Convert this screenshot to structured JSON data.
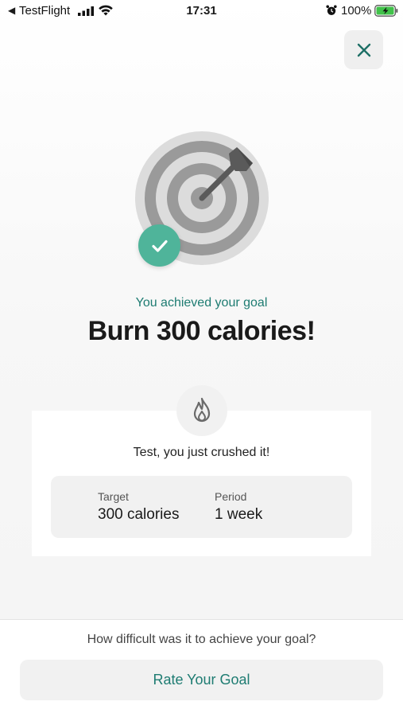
{
  "status_bar": {
    "back_glyph": "◀",
    "app_name": "TestFlight",
    "time": "17:31",
    "battery_percent": "100%",
    "icons": [
      "signal-icon",
      "wifi-icon",
      "alarm-icon",
      "battery-charging-icon"
    ]
  },
  "header": {
    "close_icon": "close-icon"
  },
  "hero": {
    "illustration": "target-dart-icon",
    "badge_icon": "check-icon",
    "subtitle": "You achieved your goal",
    "title": "Burn 300 calories!"
  },
  "card": {
    "icon": "flame-icon",
    "message": "Test, you just crushed it!",
    "stats": [
      {
        "label": "Target",
        "value": "300 calories"
      },
      {
        "label": "Period",
        "value": "1 week"
      }
    ]
  },
  "footer": {
    "question": "How difficult was it to achieve your goal?",
    "rate_button": "Rate Your Goal"
  },
  "colors": {
    "accent": "#1e7c72",
    "badge": "#4fb49a",
    "panel": "#f1f1f1"
  }
}
